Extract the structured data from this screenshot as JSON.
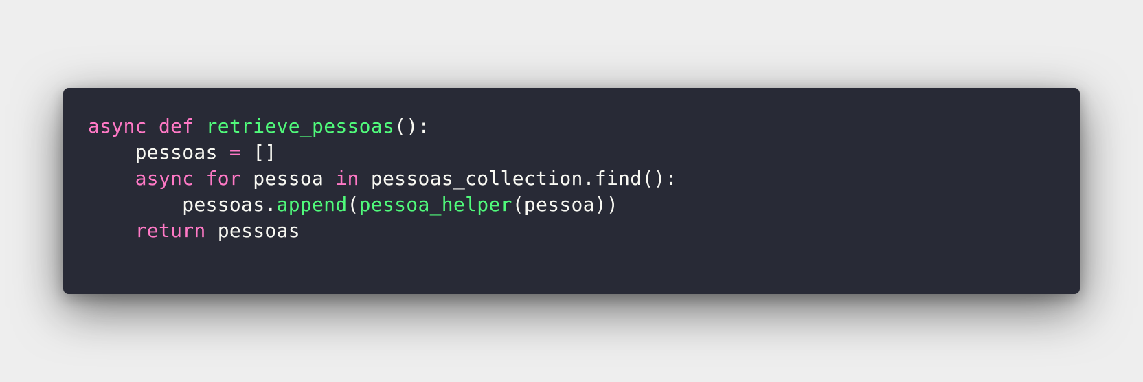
{
  "editor": {
    "language": "python",
    "colors": {
      "background": "#282a36",
      "page_background": "#eeeeee",
      "keyword": "#ff79c6",
      "function": "#50fa7b",
      "operator": "#ff79c6",
      "text": "#f8f8f2"
    },
    "lines": [
      {
        "indent": "",
        "tokens": [
          {
            "type": "keyword",
            "text": "async"
          },
          {
            "type": "text",
            "text": " "
          },
          {
            "type": "keyword",
            "text": "def"
          },
          {
            "type": "text",
            "text": " "
          },
          {
            "type": "function",
            "text": "retrieve_pessoas"
          },
          {
            "type": "text",
            "text": "():"
          }
        ]
      },
      {
        "indent": "    ",
        "tokens": [
          {
            "type": "text",
            "text": "pessoas "
          },
          {
            "type": "operator",
            "text": "="
          },
          {
            "type": "text",
            "text": " []"
          }
        ]
      },
      {
        "indent": "    ",
        "tokens": [
          {
            "type": "keyword",
            "text": "async"
          },
          {
            "type": "text",
            "text": " "
          },
          {
            "type": "keyword",
            "text": "for"
          },
          {
            "type": "text",
            "text": " pessoa "
          },
          {
            "type": "keyword",
            "text": "in"
          },
          {
            "type": "text",
            "text": " pessoas_collection.find():"
          }
        ]
      },
      {
        "indent": "        ",
        "tokens": [
          {
            "type": "text",
            "text": "pessoas."
          },
          {
            "type": "function",
            "text": "append"
          },
          {
            "type": "text",
            "text": "("
          },
          {
            "type": "function",
            "text": "pessoa_helper"
          },
          {
            "type": "text",
            "text": "(pessoa))"
          }
        ]
      },
      {
        "indent": "    ",
        "tokens": [
          {
            "type": "keyword",
            "text": "return"
          },
          {
            "type": "text",
            "text": " pessoas"
          }
        ]
      }
    ]
  }
}
